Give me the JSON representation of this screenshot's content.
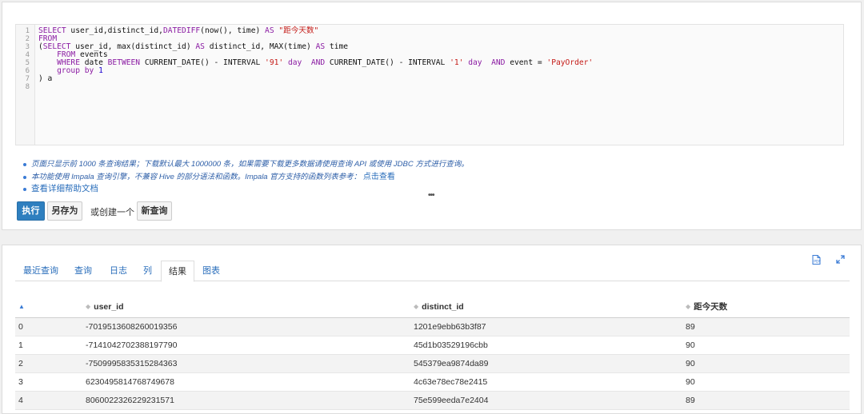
{
  "editor": {
    "line_numbers": [
      "1",
      "2",
      "3",
      "4",
      "5",
      "6",
      "7",
      "8"
    ]
  },
  "notes": {
    "note1": "页面只显示前 1000 条查询结果；下载默认最大 1000000 条，如果需要下载更多数据请使用查询 API 或使用 JDBC 方式进行查询。",
    "note2_text": "本功能使用 Impala 查询引擎，不兼容 Hive 的部分语法和函数。Impala 官方支持的函数列表参考：",
    "note2_link": "点击查看",
    "help_link": "查看详细帮助文档",
    "more": "•••"
  },
  "actions": {
    "run": "执行",
    "save_as": "另存为",
    "or_create": "或创建一个",
    "new_query": "新查询"
  },
  "tabs": [
    "最近查询",
    "查询",
    "日志",
    "列",
    "结果",
    "图表"
  ],
  "active_tab": "结果",
  "table": {
    "headers": [
      "",
      "user_id",
      "distinct_id",
      "距今天数"
    ],
    "rows": [
      [
        "0",
        "-7019513608260019356",
        "1201e9ebb63b3f87",
        "89"
      ],
      [
        "1",
        "-7141042702388197790",
        "45d1b03529196cbb",
        "90"
      ],
      [
        "2",
        "-7509995835315284363",
        "545379ea9874da89",
        "90"
      ],
      [
        "3",
        "6230495814768749678",
        "4c63e78ec78e2415",
        "90"
      ],
      [
        "4",
        "8060022326229231571",
        "75e599eeda7e2404",
        "89"
      ]
    ]
  },
  "colors": {
    "primary": "#2e7fbf",
    "link": "#2a6ebb"
  }
}
